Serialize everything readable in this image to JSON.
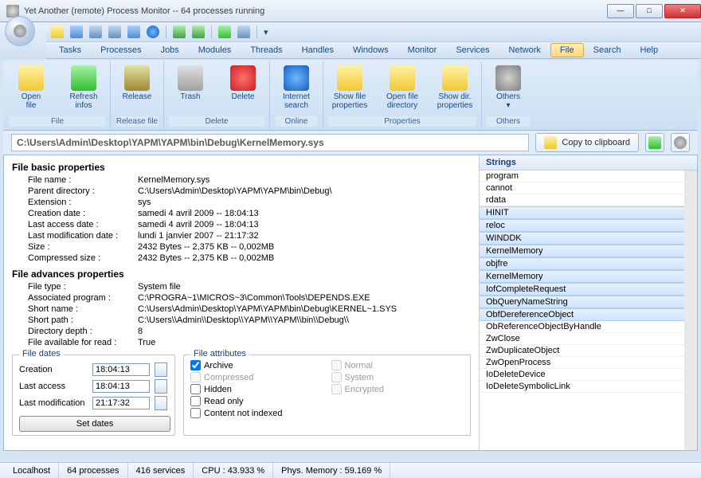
{
  "window": {
    "title": "Yet Another (remote) Process Monitor -- 64 processes running"
  },
  "menu": {
    "items": [
      "Tasks",
      "Processes",
      "Jobs",
      "Modules",
      "Threads",
      "Handles",
      "Windows",
      "Monitor",
      "Services",
      "Network",
      "File",
      "Search",
      "Help"
    ],
    "active": "File"
  },
  "ribbon": {
    "groups": [
      {
        "label": "File",
        "buttons": [
          {
            "name": "open-file",
            "line1": "Open",
            "line2": "file",
            "iconClass": "c-folder"
          },
          {
            "name": "refresh-infos",
            "line1": "Refresh",
            "line2": "infos",
            "iconClass": "c-green"
          }
        ]
      },
      {
        "label": "Release file",
        "buttons": [
          {
            "name": "release",
            "line1": "Release",
            "line2": "",
            "iconClass": "c-lock"
          }
        ]
      },
      {
        "label": "Delete",
        "buttons": [
          {
            "name": "trash",
            "line1": "Trash",
            "line2": "",
            "iconClass": "c-trash"
          },
          {
            "name": "delete",
            "line1": "Delete",
            "line2": "",
            "iconClass": "c-del"
          }
        ]
      },
      {
        "label": "Online",
        "buttons": [
          {
            "name": "internet-search",
            "line1": "Internet",
            "line2": "search",
            "iconClass": "c-ie"
          }
        ]
      },
      {
        "label": "Properties",
        "buttons": [
          {
            "name": "show-file-props",
            "line1": "Show file",
            "line2": "properties",
            "iconClass": "c-folder"
          },
          {
            "name": "open-file-dir",
            "line1": "Open file",
            "line2": "directory",
            "iconClass": "c-folder"
          },
          {
            "name": "show-dir-props",
            "line1": "Show dir.",
            "line2": "properties",
            "iconClass": "c-folder"
          }
        ]
      },
      {
        "label": "Others",
        "buttons": [
          {
            "name": "others",
            "line1": "Others",
            "line2": "▾",
            "iconClass": "c-gear"
          }
        ]
      }
    ]
  },
  "path": "C:\\Users\\Admin\\Desktop\\YAPM\\YAPM\\bin\\Debug\\KernelMemory.sys",
  "copy_label": "Copy to clipboard",
  "basic": {
    "title": "File basic properties",
    "rows": [
      [
        "File name :",
        "KernelMemory.sys"
      ],
      [
        "Parent directory :",
        "C:\\Users\\Admin\\Desktop\\YAPM\\YAPM\\bin\\Debug\\"
      ],
      [
        "Extension :",
        "sys"
      ],
      [
        "Creation date :",
        "samedi 4 avril 2009 -- 18:04:13"
      ],
      [
        "Last access date :",
        "samedi 4 avril 2009 -- 18:04:13"
      ],
      [
        "Last modification date :",
        "lundi 1 janvier 2007 -- 21:17:32"
      ],
      [
        "Size :",
        "2432 Bytes -- 2,375 KB -- 0,002MB"
      ],
      [
        "Compressed size :",
        "2432 Bytes -- 2,375 KB -- 0,002MB"
      ]
    ]
  },
  "advanced": {
    "title": "File advances properties",
    "rows": [
      [
        "File type :",
        "System file"
      ],
      [
        "Associated program :",
        "C:\\PROGRA~1\\MICROS~3\\Common\\Tools\\DEPENDS.EXE"
      ],
      [
        "Short name :",
        "C:\\Users\\Admin\\Desktop\\YAPM\\YAPM\\bin\\Debug\\KERNEL~1.SYS"
      ],
      [
        "Short path :",
        "C:\\Users\\\\Admin\\\\Desktop\\\\YAPM\\\\YAPM\\\\bin\\\\Debug\\\\"
      ],
      [
        "Directory depth :",
        "8"
      ],
      [
        "File available for read :",
        "True"
      ]
    ]
  },
  "dates": {
    "title": "File dates",
    "rows": [
      [
        "Creation",
        "18:04:13"
      ],
      [
        "Last access",
        "18:04:13"
      ],
      [
        "Last modification",
        "21:17:32"
      ]
    ],
    "button": "Set dates"
  },
  "attrs": {
    "title": "File attributes",
    "items": [
      {
        "label": "Archive",
        "checked": true,
        "disabled": false
      },
      {
        "label": "Normal",
        "checked": false,
        "disabled": true
      },
      {
        "label": "Compressed",
        "checked": false,
        "disabled": true
      },
      {
        "label": "System",
        "checked": false,
        "disabled": true
      },
      {
        "label": "Hidden",
        "checked": false,
        "disabled": false
      },
      {
        "label": "Encrypted",
        "checked": false,
        "disabled": true
      },
      {
        "label": "Read only",
        "checked": false,
        "disabled": false
      },
      {
        "label": "",
        "checked": false,
        "disabled": true
      },
      {
        "label": "Content not indexed",
        "checked": false,
        "disabled": false
      }
    ]
  },
  "strings": {
    "header": "Strings",
    "items": [
      {
        "t": "program",
        "sel": false
      },
      {
        "t": "cannot",
        "sel": false
      },
      {
        "t": "rdata",
        "sel": false
      },
      {
        "t": "HINIT",
        "sel": true
      },
      {
        "t": "reloc",
        "sel": true
      },
      {
        "t": "WINDDK",
        "sel": true
      },
      {
        "t": "KernelMemory",
        "sel": true
      },
      {
        "t": "objfre",
        "sel": true
      },
      {
        "t": "KernelMemory",
        "sel": true
      },
      {
        "t": "IofCompleteRequest",
        "sel": true
      },
      {
        "t": "ObQueryNameString",
        "sel": true
      },
      {
        "t": "ObfDereferenceObject",
        "sel": true
      },
      {
        "t": "ObReferenceObjectByHandle",
        "sel": false
      },
      {
        "t": "ZwClose",
        "sel": false
      },
      {
        "t": "ZwDuplicateObject",
        "sel": false
      },
      {
        "t": "ZwOpenProcess",
        "sel": false
      },
      {
        "t": "IoDeleteDevice",
        "sel": false
      },
      {
        "t": "IoDeleteSymbolicLink",
        "sel": false
      }
    ]
  },
  "status": {
    "host": "Localhost",
    "procs": "64 processes",
    "svcs": "416 services",
    "cpu": "CPU : 43.933 %",
    "mem": "Phys. Memory : 59.169 %"
  }
}
